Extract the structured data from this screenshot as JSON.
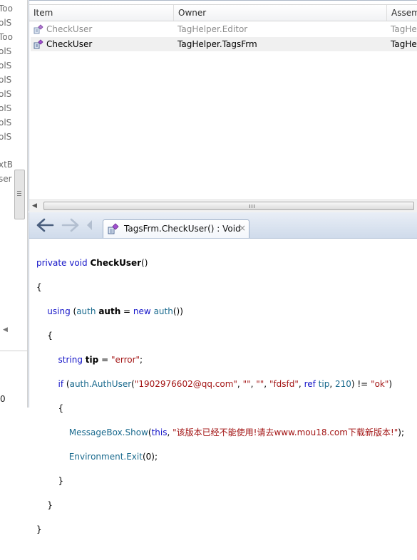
{
  "left_panel": {
    "items": [
      "Too",
      "olS",
      "Too",
      "olS",
      "olS",
      "olS",
      "olS",
      "olS",
      "olS",
      "olS"
    ],
    "lower_items": [
      "xtB",
      "ser"
    ],
    "bottom_text": "0"
  },
  "list": {
    "columns": [
      "Item",
      "Owner",
      "Assem"
    ],
    "rows": [
      {
        "item": "CheckUser",
        "owner": "TagHelper.Editor",
        "assembly": "TagHe"
      },
      {
        "item": "CheckUser",
        "owner": "TagHelper.TagsFrm",
        "assembly": "TagHe"
      }
    ],
    "selected_index": 1
  },
  "editor": {
    "tab_label": "TagsFrm.CheckUser() : Void",
    "tab_close": "×",
    "code": {
      "l1_private": "private",
      "l1_void": "void",
      "l1_name": "CheckUser",
      "l1_parens": "()",
      "brace_open": "{",
      "brace_close": "}",
      "l3_using": "using",
      "l3_open": "(",
      "l3_type": "auth",
      "l3_var": "auth",
      "l3_eq": " = ",
      "l3_new": "new",
      "l3_ctor": "auth",
      "l3_close": "())",
      "l5_type": "string",
      "l5_var": "tip",
      "l5_eq": " = ",
      "l5_value": "\"error\"",
      "l5_semi": ";",
      "l6_if": "if",
      "l6_open": "(",
      "l6_call": "auth.AuthUser",
      "l6_paren": "(",
      "l6_arg1": "\"1902976602@qq.com\"",
      "l6_arg2": "\"\"",
      "l6_arg3": "\"\"",
      "l6_arg4": "\"fdsfd\"",
      "l6_ref": "ref",
      "l6_tip": "tip",
      "l6_num": "210",
      "l6_ne": ") != ",
      "l6_ok": "\"ok\"",
      "l6_end": ")",
      "comma": ", ",
      "l8_call": "MessageBox.Show",
      "l8_open": "(",
      "l8_this": "this",
      "l8_msg": "\"该版本已经不能使用!请去www.mou18.com下载新版本!\"",
      "l8_end": ");",
      "l9_call": "Environment.Exit",
      "l9_arg": "(0);"
    }
  },
  "colors": {
    "keyword": "#1414c8",
    "string": "#a31515",
    "identifier": "#1a6a8e",
    "toolbar": "#cfdbeb"
  }
}
